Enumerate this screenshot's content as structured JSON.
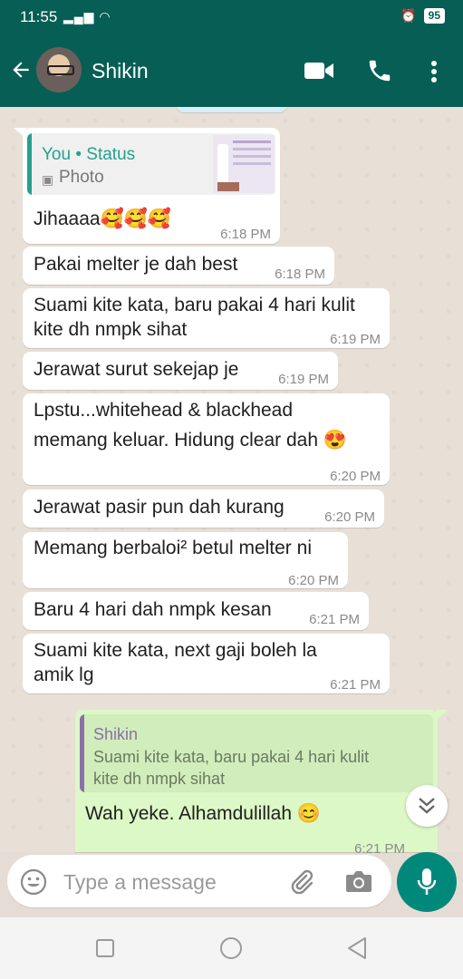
{
  "status_bar": {
    "time": "11:55",
    "battery": "95"
  },
  "header": {
    "contact_name": "Shikin"
  },
  "messages": [
    {
      "quote_title": "You • Status",
      "quote_subtitle": "Photo",
      "text": "Jihaaaa🥰🥰🥰",
      "time": "6:18 PM"
    },
    {
      "text": "Pakai melter je dah best",
      "time": "6:18 PM"
    },
    {
      "line1": "Suami kite kata, baru pakai 4 hari kulit",
      "line2": "kite dh nmpk sihat",
      "time": "6:19 PM"
    },
    {
      "text": "Jerawat surut sekejap je",
      "time": "6:19 PM"
    },
    {
      "line1": "Lpstu...whitehead & blackhead",
      "line2": "memang keluar. Hidung clear dah 😍",
      "time": "6:20 PM"
    },
    {
      "text": "Jerawat pasir pun dah kurang",
      "time": "6:20 PM"
    },
    {
      "text": "Memang berbaloi² betul melter ni",
      "time": "6:20 PM"
    },
    {
      "text": "Baru 4 hari dah nmpk kesan",
      "time": "6:21 PM"
    },
    {
      "line1": "Suami kite kata, next gaji boleh la",
      "line2": "amik lg",
      "time": "6:21 PM"
    }
  ],
  "outgoing": {
    "quote_author": "Shikin",
    "quote_line1": "Suami kite kata, baru pakai 4 hari kulit",
    "quote_line2": "kite dh nmpk sihat",
    "text": "Wah yeke. Alhamdulillah 😊",
    "time": "6:21 PM"
  },
  "composer": {
    "placeholder": "Type a message"
  },
  "colors": {
    "header": "#075e54",
    "outgoing_bubble": "#dcf8c6",
    "mic": "#00897b",
    "quote_bar_in": "#25a18e",
    "quote_bar_out": "#8b6fa9"
  }
}
